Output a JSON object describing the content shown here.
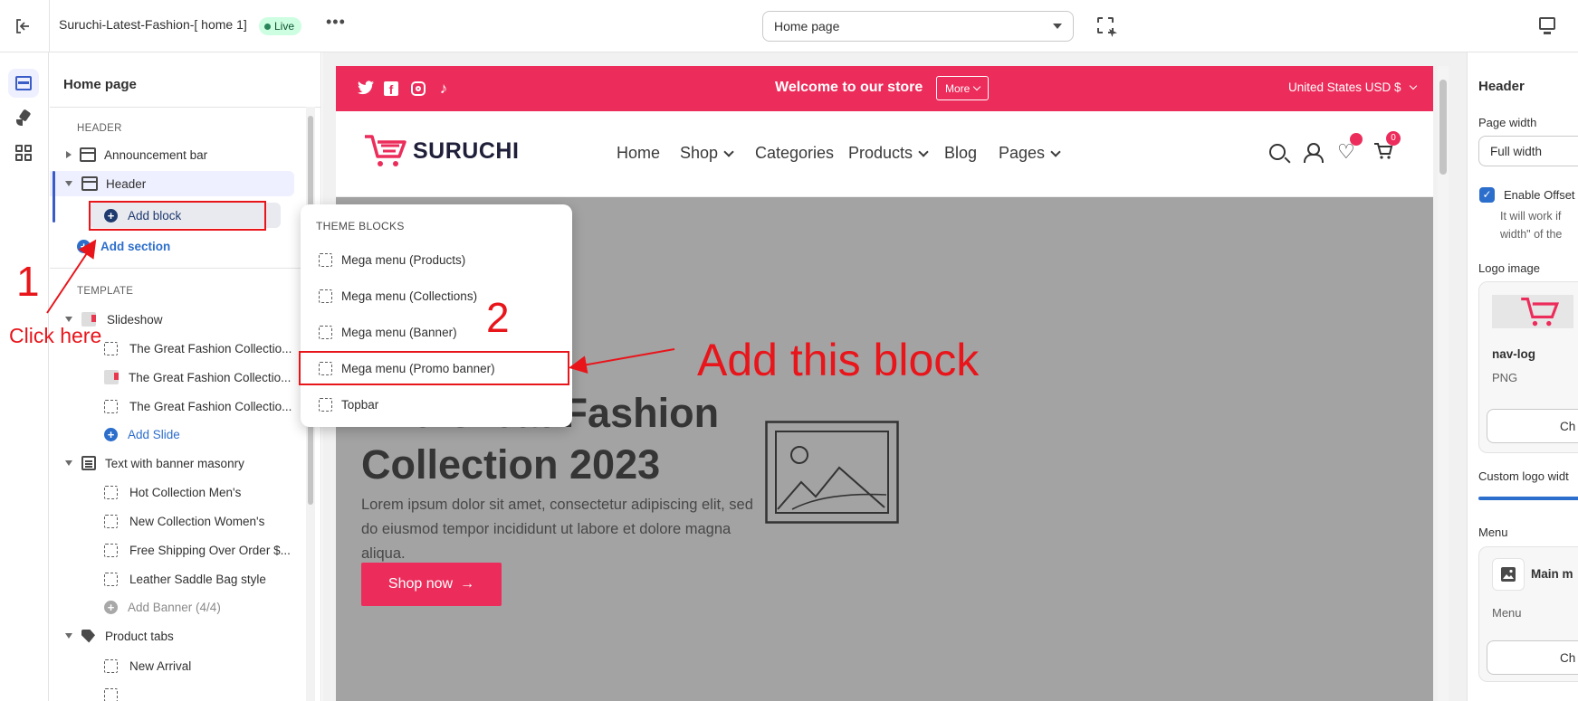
{
  "topbar": {
    "store_name": "Suruchi-Latest-Fashion-[ home 1]",
    "live_badge": "Live",
    "more_icon": "ellipsis-icon",
    "page_selector_value": "Home page",
    "inspector_icon": "inspector-cursor-icon",
    "device_icon": "desktop-icon"
  },
  "rail": {
    "items": [
      {
        "name": "sections-icon",
        "active": true
      },
      {
        "name": "theme-settings-icon",
        "active": false
      },
      {
        "name": "apps-icon",
        "active": false
      }
    ]
  },
  "sidebar": {
    "title": "Home page",
    "header_group": "HEADER",
    "announcement_bar": "Announcement bar",
    "header": "Header",
    "add_block": "Add block",
    "add_section": "Add section",
    "template_group": "TEMPLATE",
    "slideshow": "Slideshow",
    "slides": [
      "The Great Fashion Collectio...",
      "The Great Fashion Collectio...",
      "The Great Fashion Collectio..."
    ],
    "add_slide": "Add Slide",
    "masonry": "Text with banner masonry",
    "banners": [
      "Hot Collection Men's",
      "New Collection Women's",
      "Free Shipping Over Order $...",
      "Leather Saddle Bag style"
    ],
    "add_banner": "Add Banner (4/4)",
    "product_tabs": "Product tabs",
    "tabs": [
      "New Arrival"
    ]
  },
  "dropdown": {
    "title": "THEME BLOCKS",
    "items": [
      "Mega menu (Products)",
      "Mega menu (Collections)",
      "Mega menu (Banner)",
      "Mega menu (Promo banner)",
      "Topbar"
    ]
  },
  "annotations": {
    "step1": "1",
    "step1_text": "Click here",
    "step2": "2",
    "step2_text": "Add this block",
    "color": "#e8151b"
  },
  "store": {
    "announcement": "Welcome to our store",
    "more_button": "More",
    "currency": "United States USD $",
    "logo_text": "SURUCHI",
    "nav": [
      "Home",
      "Shop",
      "Categories",
      "Products",
      "Blog",
      "Pages"
    ],
    "cart_count": "0",
    "hero_title": "The Great Fashion Collection 2023",
    "hero_desc": "Lorem ipsum dolor sit amet, consectetur adipiscing elit, sed do eiusmod tempor incididunt ut labore et dolore magna aliqua.",
    "hero_button": "Shop now",
    "brand_color": "#ec2d5b"
  },
  "rpanel": {
    "title": "Header",
    "page_width_label": "Page width",
    "page_width_value": "Full width",
    "enable_offset_label": "Enable Offset",
    "offset_help_1": "It will work if",
    "offset_help_2": "width\" of the",
    "logo_image_label": "Logo image",
    "logo_file_name": "nav-log",
    "logo_file_type": "PNG",
    "change_button": "Ch",
    "custom_logo_width": "Custom logo widt",
    "menu_label": "Menu",
    "menu_name": "Main m",
    "menu_sub": "Menu",
    "menu_change": "Ch"
  }
}
